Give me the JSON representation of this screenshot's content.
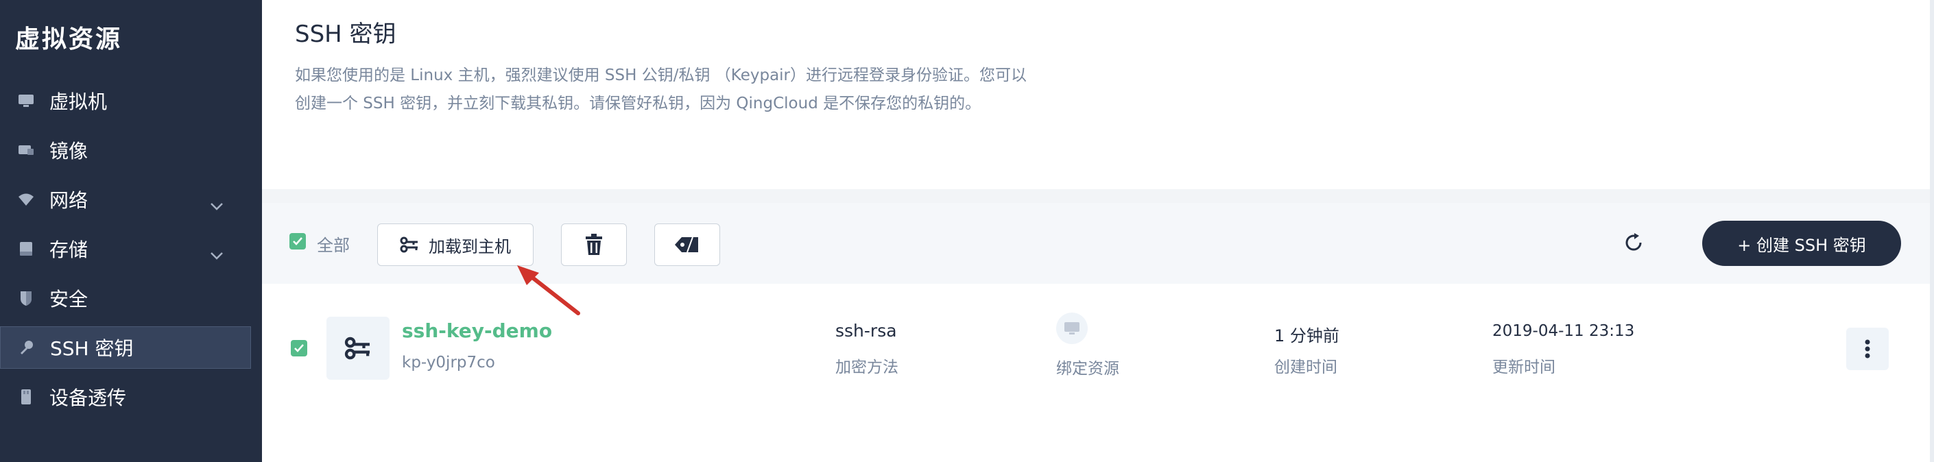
{
  "sidebar": {
    "title": "虚拟资源",
    "items": [
      {
        "label": "虚拟机",
        "icon": "monitor-icon"
      },
      {
        "label": "镜像",
        "icon": "image-icon"
      },
      {
        "label": "网络",
        "icon": "wifi-icon",
        "has_children": true
      },
      {
        "label": "存储",
        "icon": "storage-icon",
        "has_children": true
      },
      {
        "label": "安全",
        "icon": "shield-icon"
      },
      {
        "label": "SSH 密钥",
        "icon": "key-icon",
        "active": true
      },
      {
        "label": "设备透传",
        "icon": "usb-icon"
      }
    ]
  },
  "header": {
    "title": "SSH 密钥",
    "description_line1": "如果您使用的是 Linux 主机，强烈建议使用 SSH 公钥/私钥 （Keypair）进行远程登录身份验证。您可以",
    "description_line2": "创建一个 SSH 密钥，并立刻下载其私钥。请保管好私钥，因为 QingCloud 是不保存您的私钥的。"
  },
  "toolbar": {
    "select_all_label": "全部",
    "select_all_checked": true,
    "attach_label": "加载到主机",
    "delete_icon": "trash-icon",
    "tag_icon": "tag-icon",
    "refresh_icon": "refresh-icon",
    "create_label": "+ 创建 SSH 密钥"
  },
  "rows": [
    {
      "checked": true,
      "icon": "ssh-key-icon",
      "name": "ssh-key-demo",
      "id": "kp-y0jrp7co",
      "encryption": "ssh-rsa",
      "encryption_label": "加密方法",
      "bound_icon": "monitor-icon",
      "bound_label": "绑定资源",
      "created": "1 分钟前",
      "created_label": "创建时间",
      "updated": "2019-04-11 23:13",
      "updated_label": "更新时间"
    }
  ],
  "colors": {
    "sidebar_bg": "#242e42",
    "accent_green": "#55bc8a",
    "primary_button": "#242e42",
    "annotation_arrow": "#d0342c"
  }
}
